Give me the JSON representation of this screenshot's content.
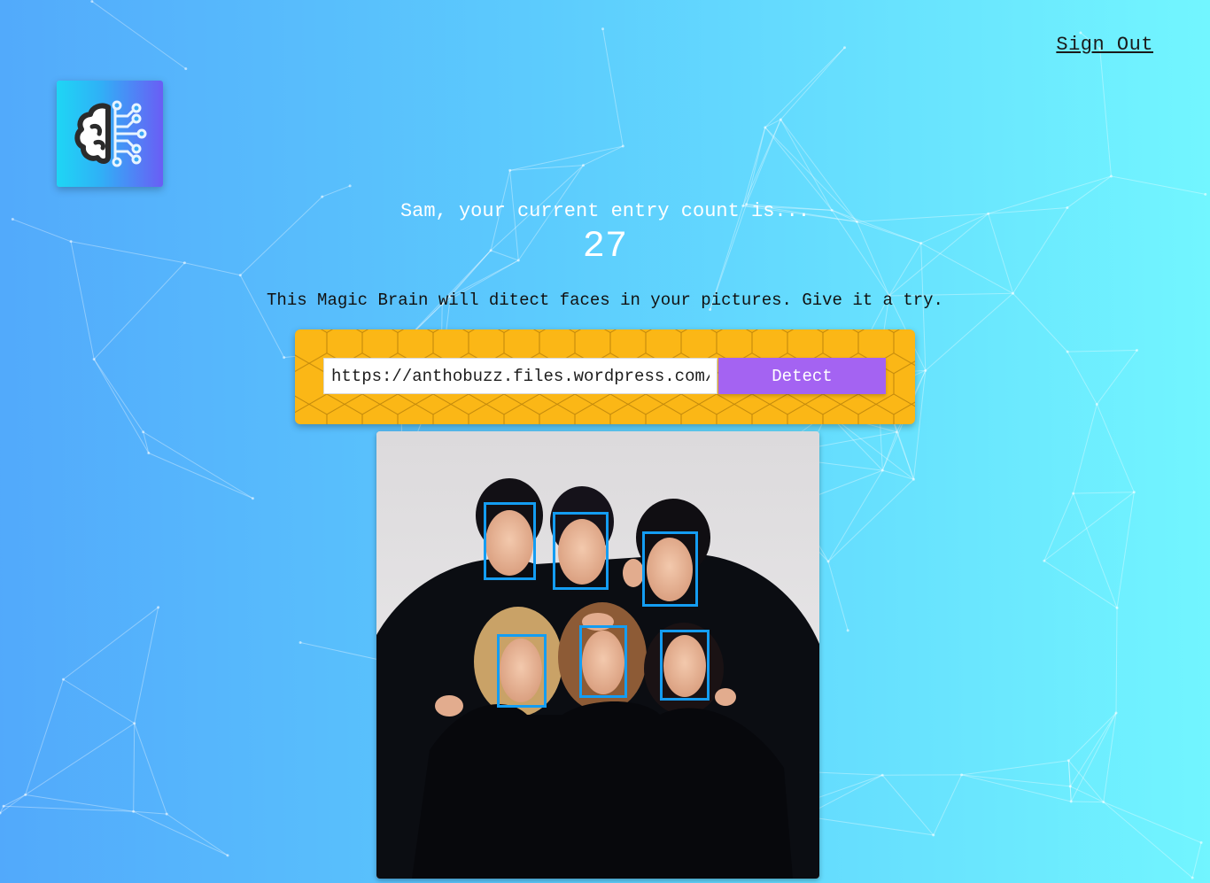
{
  "nav": {
    "signout_label": "Sign Out"
  },
  "logo": {
    "icon": "brain-circuit-icon"
  },
  "rank": {
    "greeting": "Sam, your current entry count is...",
    "count": "27"
  },
  "intro": {
    "text": "This Magic Brain will ditect faces in your pictures. Give it a try."
  },
  "form": {
    "url_value": "https://anthobuzz.files.wordpress.com/",
    "detect_label": "Detect"
  },
  "result": {
    "face_count": 6
  },
  "colors": {
    "background_start": "#52a9fb",
    "background_end": "#72f6ff",
    "panel": "#fbb716",
    "button": "#a463f2",
    "face_box": "#149df2"
  }
}
